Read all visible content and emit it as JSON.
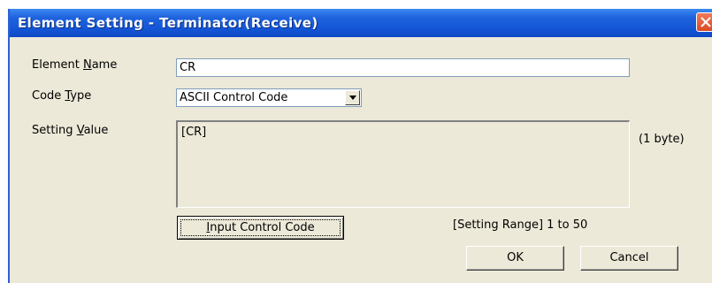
{
  "window": {
    "title": "Element Setting - Terminator(Receive)"
  },
  "form": {
    "element_name": {
      "label_pre": "Element ",
      "label_accel": "N",
      "label_post": "ame",
      "value": "CR"
    },
    "code_type": {
      "label_pre": "Code ",
      "label_accel": "T",
      "label_post": "ype",
      "selected": "ASCII Control Code"
    },
    "setting_value": {
      "label_pre": "Setting ",
      "label_accel": "V",
      "label_post": "alue",
      "value": "[CR]",
      "byte_count": "(1 byte)"
    },
    "input_control_code": {
      "label_accel": "I",
      "label_post": "nput Control Code"
    },
    "setting_range": "[Setting Range] 1 to 50"
  },
  "buttons": {
    "ok": "OK",
    "cancel": "Cancel"
  }
}
